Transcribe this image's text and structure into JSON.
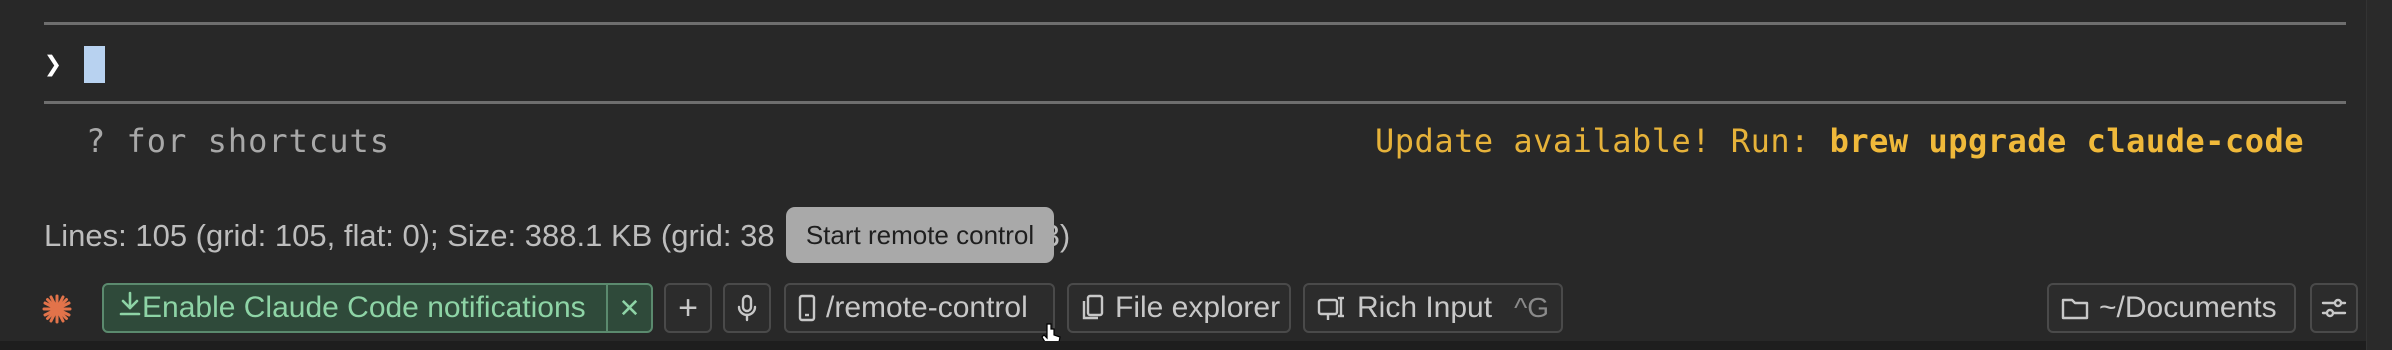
{
  "terminal": {
    "prompt_symbol": "❯",
    "shortcuts_hint": "? for shortcuts",
    "update_prefix": "Update available! Run: ",
    "update_command": "brew upgrade claude-code",
    "stats_text": "Lines: 105 (grid: 105, flat: 0); Size: 388.1 KB (grid: 38",
    "stats_tail": "3)"
  },
  "tooltip": {
    "text": "Start remote control"
  },
  "toolbar": {
    "brand_icon": "claude-sparkle-icon",
    "notifications_label": "Enable Claude Code notifications",
    "notifications_close": "✕",
    "add_label": "+",
    "remote_label": "/remote-control",
    "file_explorer_label": "File explorer",
    "rich_input_label": "Rich Input",
    "rich_input_shortcut": "^G",
    "directory_label": "~/Documents"
  },
  "colors": {
    "background": "#282828",
    "update_text": "#e6b23a",
    "notification_bg": "#2f4a3a",
    "notification_text": "#8ed4a6",
    "brand_orange": "#e2734a"
  }
}
